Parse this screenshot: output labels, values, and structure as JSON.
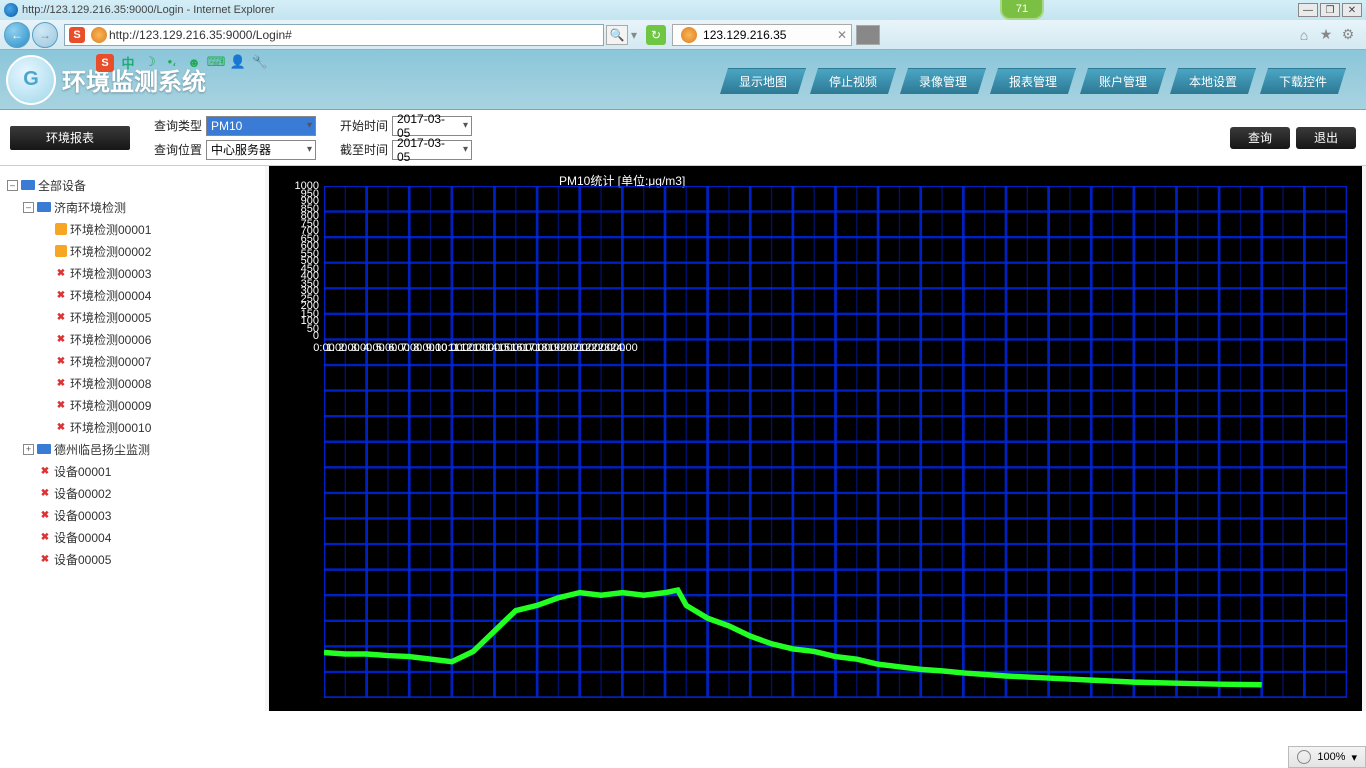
{
  "browser": {
    "title": "http://123.129.216.35:9000/Login - Internet Explorer",
    "url": "http://123.129.216.35:9000/Login#",
    "tab_label": "123.129.216.35",
    "badge": "71",
    "zoom": "100%"
  },
  "app": {
    "title": "环境监测系统",
    "nav": [
      "显示地图",
      "停止视频",
      "录像管理",
      "报表管理",
      "账户管理",
      "本地设置",
      "下载控件"
    ]
  },
  "filters": {
    "env_report": "环境报表",
    "query_type_label": "查询类型",
    "query_type_value": "PM10",
    "query_loc_label": "查询位置",
    "query_loc_value": "中心服务器",
    "start_time_label": "开始时间",
    "start_time_value": "2017-03-05",
    "end_time_label": "截至时间",
    "end_time_value": "2017-03-05",
    "query_btn": "查询",
    "exit_btn": "退出"
  },
  "tree": {
    "root": "全部设备",
    "g1": {
      "name": "济南环境检测",
      "items": [
        {
          "label": "环境检测00001",
          "icon": "orange"
        },
        {
          "label": "环境检测00002",
          "icon": "orange"
        },
        {
          "label": "环境检测00003",
          "icon": "x"
        },
        {
          "label": "环境检测00004",
          "icon": "x"
        },
        {
          "label": "环境检测00005",
          "icon": "x"
        },
        {
          "label": "环境检测00006",
          "icon": "x"
        },
        {
          "label": "环境检测00007",
          "icon": "x"
        },
        {
          "label": "环境检测00008",
          "icon": "x"
        },
        {
          "label": "环境检测00009",
          "icon": "x"
        },
        {
          "label": "环境检测00010",
          "icon": "x"
        }
      ]
    },
    "g2": {
      "name": "德州临邑扬尘监测"
    },
    "loose": [
      {
        "label": "设备00001",
        "icon": "x"
      },
      {
        "label": "设备00002",
        "icon": "x"
      },
      {
        "label": "设备00003",
        "icon": "x"
      },
      {
        "label": "设备00004",
        "icon": "x"
      },
      {
        "label": "设备00005",
        "icon": "x"
      }
    ]
  },
  "chart_data": {
    "type": "line",
    "title": "PM10统计   [单位:μg/m3]",
    "ylabel": "",
    "xlabel": "",
    "ylim": [
      0,
      1000
    ],
    "xlim": [
      0,
      24
    ],
    "y_ticks": [
      0,
      50,
      100,
      150,
      200,
      250,
      300,
      350,
      400,
      450,
      500,
      550,
      600,
      650,
      700,
      750,
      800,
      850,
      900,
      950,
      1000
    ],
    "x_ticks": [
      "0:00",
      "1:00",
      "2:00",
      "3:00",
      "4:00",
      "5:00",
      "6:00",
      "7:00",
      "8:00",
      "9:00",
      "10:00",
      "11:00",
      "12:00",
      "13:00",
      "14:00",
      "15:00",
      "16:00",
      "17:00",
      "18:00",
      "19:00",
      "20:00",
      "21:00",
      "22:00",
      "23:00",
      "24:00"
    ],
    "series": [
      {
        "name": "PM10",
        "x": [
          0,
          0.5,
          1,
          1.5,
          2,
          2.5,
          3,
          3.5,
          4,
          4.5,
          5,
          5.5,
          6,
          6.5,
          7,
          7.5,
          8,
          8.3,
          8.5,
          9,
          9.5,
          10,
          10.5,
          11,
          11.5,
          12,
          12.5,
          13,
          13.5,
          14,
          14.5,
          15,
          16,
          17,
          18,
          19,
          20,
          21,
          22
        ],
        "values": [
          88,
          85,
          85,
          82,
          80,
          75,
          70,
          90,
          130,
          170,
          180,
          195,
          205,
          200,
          205,
          200,
          205,
          210,
          180,
          155,
          140,
          120,
          105,
          95,
          90,
          80,
          75,
          65,
          60,
          55,
          52,
          48,
          42,
          38,
          34,
          30,
          28,
          26,
          25
        ]
      }
    ]
  }
}
